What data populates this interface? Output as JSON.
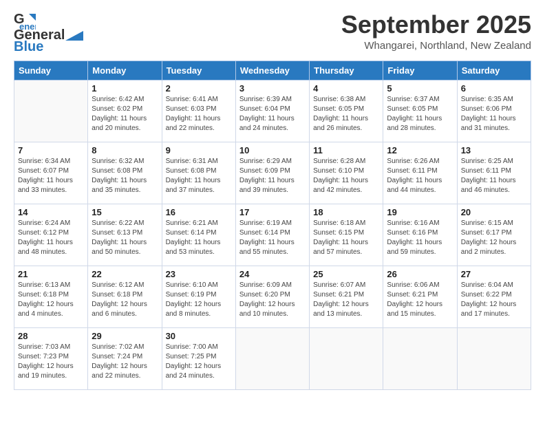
{
  "header": {
    "logo_general": "General",
    "logo_blue": "Blue",
    "month_title": "September 2025",
    "subtitle": "Whangarei, Northland, New Zealand"
  },
  "days_of_week": [
    "Sunday",
    "Monday",
    "Tuesday",
    "Wednesday",
    "Thursday",
    "Friday",
    "Saturday"
  ],
  "weeks": [
    [
      {
        "day": "",
        "info": ""
      },
      {
        "day": "1",
        "info": "Sunrise: 6:42 AM\nSunset: 6:02 PM\nDaylight: 11 hours\nand 20 minutes."
      },
      {
        "day": "2",
        "info": "Sunrise: 6:41 AM\nSunset: 6:03 PM\nDaylight: 11 hours\nand 22 minutes."
      },
      {
        "day": "3",
        "info": "Sunrise: 6:39 AM\nSunset: 6:04 PM\nDaylight: 11 hours\nand 24 minutes."
      },
      {
        "day": "4",
        "info": "Sunrise: 6:38 AM\nSunset: 6:05 PM\nDaylight: 11 hours\nand 26 minutes."
      },
      {
        "day": "5",
        "info": "Sunrise: 6:37 AM\nSunset: 6:05 PM\nDaylight: 11 hours\nand 28 minutes."
      },
      {
        "day": "6",
        "info": "Sunrise: 6:35 AM\nSunset: 6:06 PM\nDaylight: 11 hours\nand 31 minutes."
      }
    ],
    [
      {
        "day": "7",
        "info": "Sunrise: 6:34 AM\nSunset: 6:07 PM\nDaylight: 11 hours\nand 33 minutes."
      },
      {
        "day": "8",
        "info": "Sunrise: 6:32 AM\nSunset: 6:08 PM\nDaylight: 11 hours\nand 35 minutes."
      },
      {
        "day": "9",
        "info": "Sunrise: 6:31 AM\nSunset: 6:08 PM\nDaylight: 11 hours\nand 37 minutes."
      },
      {
        "day": "10",
        "info": "Sunrise: 6:29 AM\nSunset: 6:09 PM\nDaylight: 11 hours\nand 39 minutes."
      },
      {
        "day": "11",
        "info": "Sunrise: 6:28 AM\nSunset: 6:10 PM\nDaylight: 11 hours\nand 42 minutes."
      },
      {
        "day": "12",
        "info": "Sunrise: 6:26 AM\nSunset: 6:11 PM\nDaylight: 11 hours\nand 44 minutes."
      },
      {
        "day": "13",
        "info": "Sunrise: 6:25 AM\nSunset: 6:11 PM\nDaylight: 11 hours\nand 46 minutes."
      }
    ],
    [
      {
        "day": "14",
        "info": "Sunrise: 6:24 AM\nSunset: 6:12 PM\nDaylight: 11 hours\nand 48 minutes."
      },
      {
        "day": "15",
        "info": "Sunrise: 6:22 AM\nSunset: 6:13 PM\nDaylight: 11 hours\nand 50 minutes."
      },
      {
        "day": "16",
        "info": "Sunrise: 6:21 AM\nSunset: 6:14 PM\nDaylight: 11 hours\nand 53 minutes."
      },
      {
        "day": "17",
        "info": "Sunrise: 6:19 AM\nSunset: 6:14 PM\nDaylight: 11 hours\nand 55 minutes."
      },
      {
        "day": "18",
        "info": "Sunrise: 6:18 AM\nSunset: 6:15 PM\nDaylight: 11 hours\nand 57 minutes."
      },
      {
        "day": "19",
        "info": "Sunrise: 6:16 AM\nSunset: 6:16 PM\nDaylight: 11 hours\nand 59 minutes."
      },
      {
        "day": "20",
        "info": "Sunrise: 6:15 AM\nSunset: 6:17 PM\nDaylight: 12 hours\nand 2 minutes."
      }
    ],
    [
      {
        "day": "21",
        "info": "Sunrise: 6:13 AM\nSunset: 6:18 PM\nDaylight: 12 hours\nand 4 minutes."
      },
      {
        "day": "22",
        "info": "Sunrise: 6:12 AM\nSunset: 6:18 PM\nDaylight: 12 hours\nand 6 minutes."
      },
      {
        "day": "23",
        "info": "Sunrise: 6:10 AM\nSunset: 6:19 PM\nDaylight: 12 hours\nand 8 minutes."
      },
      {
        "day": "24",
        "info": "Sunrise: 6:09 AM\nSunset: 6:20 PM\nDaylight: 12 hours\nand 10 minutes."
      },
      {
        "day": "25",
        "info": "Sunrise: 6:07 AM\nSunset: 6:21 PM\nDaylight: 12 hours\nand 13 minutes."
      },
      {
        "day": "26",
        "info": "Sunrise: 6:06 AM\nSunset: 6:21 PM\nDaylight: 12 hours\nand 15 minutes."
      },
      {
        "day": "27",
        "info": "Sunrise: 6:04 AM\nSunset: 6:22 PM\nDaylight: 12 hours\nand 17 minutes."
      }
    ],
    [
      {
        "day": "28",
        "info": "Sunrise: 7:03 AM\nSunset: 7:23 PM\nDaylight: 12 hours\nand 19 minutes."
      },
      {
        "day": "29",
        "info": "Sunrise: 7:02 AM\nSunset: 7:24 PM\nDaylight: 12 hours\nand 22 minutes."
      },
      {
        "day": "30",
        "info": "Sunrise: 7:00 AM\nSunset: 7:25 PM\nDaylight: 12 hours\nand 24 minutes."
      },
      {
        "day": "",
        "info": ""
      },
      {
        "day": "",
        "info": ""
      },
      {
        "day": "",
        "info": ""
      },
      {
        "day": "",
        "info": ""
      }
    ]
  ]
}
